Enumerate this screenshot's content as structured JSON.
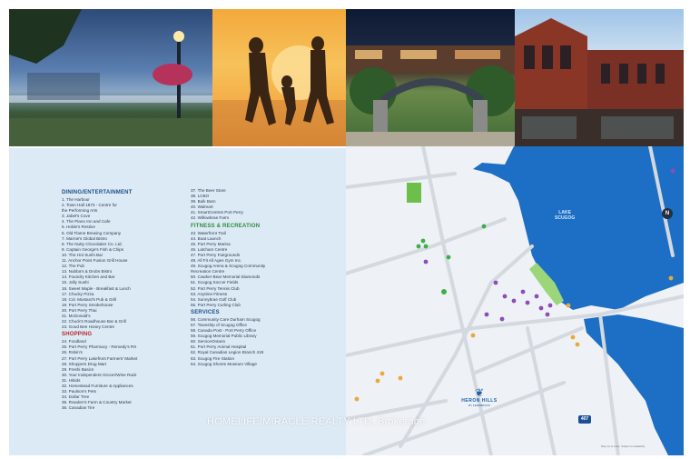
{
  "photos": [
    "Waterfront at dusk",
    "Family on beach at sunset",
    "Downtown archway at night",
    "Historic brick storefronts"
  ],
  "dining": {
    "title": "DINING/ENTERTAINMENT",
    "items": [
      "1.   The Harbour",
      "2.   Town Hall 1873 - Centre for",
      "      the Performing Arts",
      "3.   Jabel's Cove",
      "4.   The Piano Inn and Cafe",
      "5.   Holde's Restive",
      "6.   Old Flame Brewing Company",
      "7.   Marnie's Global Bistro",
      "8.   The Nutty Chocolatier Co. Ltd.",
      "9.   Captain George's Fish & Chips",
      "10. The Hot Sushi Bar",
      "11. Anchor Point Fusion Grill House",
      "12. The Pub",
      "13. Nubba's & Drubs Bistro",
      "14. Foundry Kitchen and Bar",
      "15. Jolly Sushi",
      "16. Sweet Maple - Breakfast & Lunch",
      "17. Chucky Pizza",
      "18. Col. Mustard's Pub & Grill",
      "19. Port Perry Smokehouse",
      "20. Port Perry Thai",
      "21. McDonald's",
      "22. Chuck's Roadhouse Bar & Grill",
      "23. Good Bee Honey Centre"
    ]
  },
  "shopping": {
    "title": "SHOPPING",
    "items": [
      "24. Foodland",
      "25. Port Perry Pharmacy - Remedy's RX",
      "26. Robin's",
      "27. Port Perry Lakefront Farmers' Market",
      "28. Shoppers Drug Mart",
      "29. Freshi Basics",
      "30. Your Independent Grocer/Wine Rack",
      "31. Hi5ids",
      "32. Homestead Furniture & Appliances",
      "33. Paulson's Pets",
      "34. Dollar Tree",
      "35. Rowden's Farm & Country Market",
      "36. Canadian Tire"
    ]
  },
  "shopping_cont": [
    "37. The Beer Store",
    "38. LCBO",
    "39. Bulk Barn",
    "40. Walmart",
    "41. SmartCentres Port Perry",
    "42. Willowbrae Farm"
  ],
  "fitness": {
    "title": "FITNESS & RECREATION",
    "items": [
      "43. Waterfront Trail",
      "44. Boat Launch",
      "45. Port Perry Marina",
      "46. Latcham Centre",
      "47. Port Perry Fairgrounds",
      "48. All Fit All Ages Gym Inc.",
      "49. Scugog Arena & Scugog Community",
      "      Recreation Centre",
      "50. Cawker Bear Memorial Diamonds",
      "51. Scugog Soccer Fields",
      "52. Port Perry Tennis Club",
      "53. Anytime Fitness",
      "54. Sunnybrae Golf Club",
      "55. Port Perry Curling Club"
    ]
  },
  "services": {
    "title": "SERVICES",
    "items": [
      "56. Community Care Durham Scugog",
      "57. Township of Scugog Office",
      "58. Canada Post - Port Perry Office",
      "59. Scugog Memorial Public Library",
      "60. ServiceOntario",
      "61. Port Perry Animal Hospital",
      "62. Royal Canadian Legion Branch 419",
      "63. Scugog Fire Station",
      "64. Scugog Shores Museum Village"
    ]
  },
  "map": {
    "lake_label": "LAKE\nSCUGOG",
    "north": "N",
    "highway": "407",
    "brand_name": "HERON HILLS",
    "brand_sub": "BY FERNBROOK",
    "note": "Map not to scale. Subject to availability.",
    "watermark": "HOMELIFE/MIRACLE REALTY LTD, Brokerage"
  }
}
